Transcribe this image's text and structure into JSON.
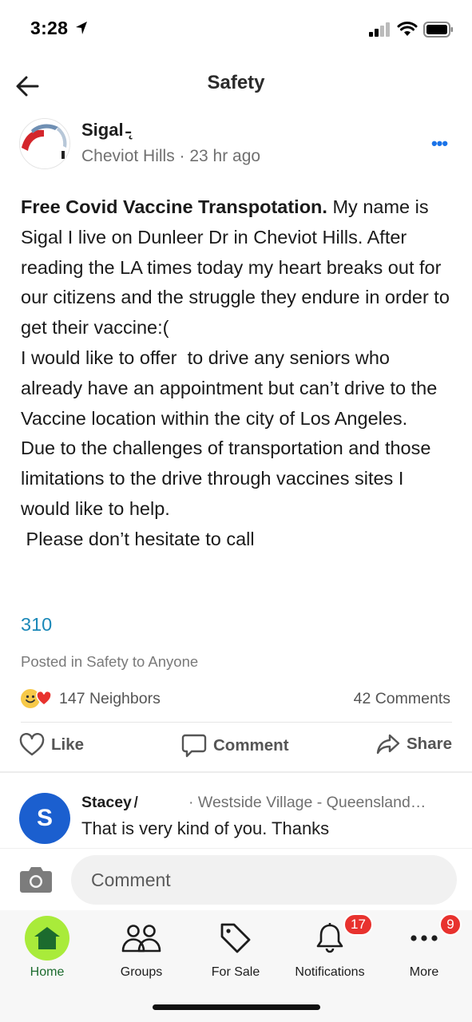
{
  "status_bar": {
    "time": "3:28"
  },
  "header": {
    "title": "Safety"
  },
  "post": {
    "author_name": "Sigal ̵˛",
    "meta": "Cheviot Hills · 23 hr ago",
    "title": "Free Covid Vaccine Transpotation.",
    "body": " My name is Sigal I live on Dunleer Dr in Cheviot Hills. After reading the LA times today my heart breaks out for our citizens and the struggle they endure in order to get their vaccine:(\nI would like to offer  to drive any seniors who already have an appointment but can’t drive to the Vaccine location within the city of Los Angeles.\nDue to the challenges of transportation and those limitations to the drive through vaccines sites I would like to help.\n Please don’t hesitate to call",
    "phone": "310",
    "posted_in": "Posted in Safety to Anyone",
    "reactions_label": "147 Neighbors",
    "comments_label": "42 Comments"
  },
  "actions": {
    "like": "Like",
    "comment": "Comment",
    "share": "Share"
  },
  "comment": {
    "avatar_initial": "S",
    "author": "Stacey ̸",
    "meta": "· Westside Village - Queensland…",
    "text": "That is very kind of you. Thanks"
  },
  "composer": {
    "placeholder": "Comment"
  },
  "tabs": [
    {
      "label": "Home",
      "badge": ""
    },
    {
      "label": "Groups",
      "badge": ""
    },
    {
      "label": "For Sale",
      "badge": ""
    },
    {
      "label": "Notifications",
      "badge": "17"
    },
    {
      "label": "More",
      "badge": "9"
    }
  ],
  "colors": {
    "accent_green": "#a9eb3a",
    "link_blue": "#1a88b8",
    "badge_red": "#e8322e",
    "avatar_blue": "#1b5fcf"
  }
}
